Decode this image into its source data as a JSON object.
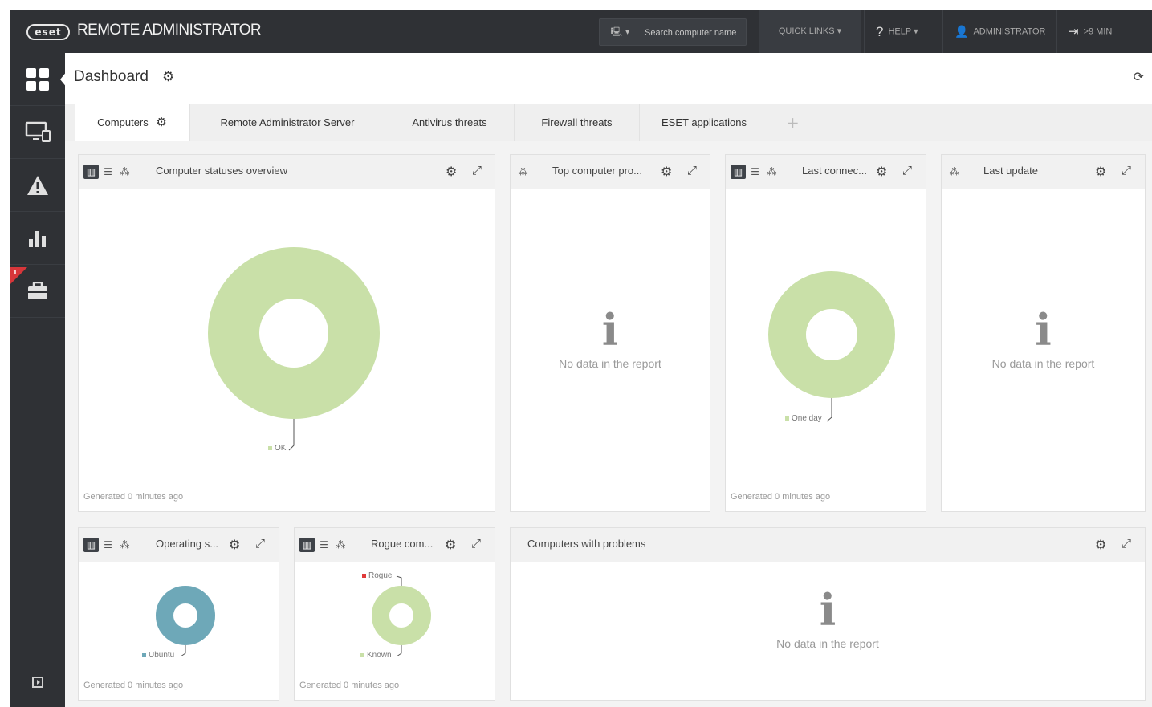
{
  "header": {
    "logo_text": "eset",
    "app_title": "REMOTE ADMINISTRATOR",
    "search": {
      "placeholder": "Search computer name"
    },
    "quick_links": "QUICK LINKS",
    "help": "HELP",
    "user": "ADMINISTRATOR",
    "session": ">9 MIN"
  },
  "sidebar": {
    "items": [
      {
        "icon": "dashboard-grid-icon",
        "active": true
      },
      {
        "icon": "computers-icon"
      },
      {
        "icon": "threats-warning-icon"
      },
      {
        "icon": "reports-chart-icon"
      },
      {
        "icon": "admin-briefcase-icon",
        "badge": "1"
      }
    ],
    "bottom_icon": "collapse-sidebar-icon"
  },
  "page": {
    "title": "Dashboard"
  },
  "tabs": [
    {
      "label": "Computers",
      "active": true
    },
    {
      "label": "Remote Administrator Server"
    },
    {
      "label": "Antivirus threats"
    },
    {
      "label": "Firewall threats"
    },
    {
      "label": "ESET applications"
    }
  ],
  "widgets": {
    "statuses": {
      "title": "Computer statuses overview",
      "generated": "Generated 0 minutes ago"
    },
    "top_problems": {
      "title": "Top computer pro...",
      "no_data": "No data in the report"
    },
    "last_connected": {
      "title": "Last connec...",
      "generated": "Generated 0 minutes ago"
    },
    "last_update": {
      "title": "Last update",
      "no_data": "No data in the report"
    },
    "os": {
      "title": "Operating s...",
      "generated": "Generated 0 minutes ago"
    },
    "rogue": {
      "title": "Rogue com...",
      "generated": "Generated 0 minutes ago"
    },
    "problems": {
      "title": "Computers with problems",
      "no_data": "No data in the report"
    }
  },
  "colors": {
    "ok_green": "#c9e0a8",
    "ubuntu_blue": "#6ea8b8",
    "rogue_red": "#e03a3a",
    "topbar": "#2f3135"
  },
  "chart_data": [
    {
      "type": "pie",
      "title": "Computer statuses overview",
      "categories": [
        "OK"
      ],
      "values": [
        100
      ],
      "colors": [
        "#c9e0a8"
      ]
    },
    {
      "type": "pie",
      "title": "Last connec...",
      "categories": [
        "One day"
      ],
      "values": [
        100
      ],
      "colors": [
        "#c9e0a8"
      ]
    },
    {
      "type": "pie",
      "title": "Operating s...",
      "categories": [
        "Ubuntu"
      ],
      "values": [
        100
      ],
      "colors": [
        "#6ea8b8"
      ]
    },
    {
      "type": "pie",
      "title": "Rogue com...",
      "categories": [
        "Rogue",
        "Known"
      ],
      "values": [
        0,
        100
      ],
      "colors": [
        "#e03a3a",
        "#c9e0a8"
      ]
    }
  ]
}
